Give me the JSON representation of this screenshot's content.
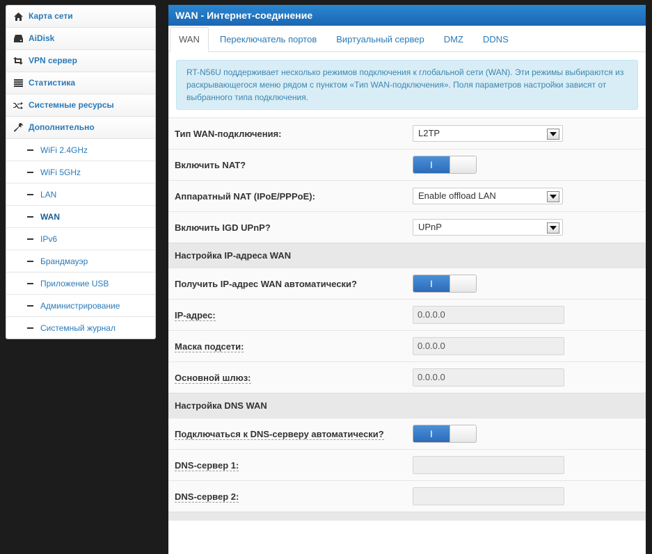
{
  "sidebar": {
    "items": [
      {
        "label": "Карта сети",
        "icon": "home-icon"
      },
      {
        "label": "AiDisk",
        "icon": "hdd-icon"
      },
      {
        "label": "VPN сервер",
        "icon": "retweet-icon"
      },
      {
        "label": "Статистика",
        "icon": "list-icon"
      },
      {
        "label": "Системные ресурсы",
        "icon": "random-icon"
      },
      {
        "label": "Дополнительно",
        "icon": "wrench-icon"
      }
    ],
    "subitems": [
      {
        "label": "WiFi 2.4GHz"
      },
      {
        "label": "WiFi 5GHz"
      },
      {
        "label": "LAN"
      },
      {
        "label": "WAN"
      },
      {
        "label": "IPv6"
      },
      {
        "label": "Брандмауэр"
      },
      {
        "label": "Приложение USB"
      },
      {
        "label": "Администрирование"
      },
      {
        "label": "Системный журнал"
      }
    ],
    "active_subitem": "WAN"
  },
  "header": {
    "title": "WAN - Интернет-соединение"
  },
  "tabs": [
    {
      "label": "WAN"
    },
    {
      "label": "Переключатель портов"
    },
    {
      "label": "Виртуальный сервер"
    },
    {
      "label": "DMZ"
    },
    {
      "label": "DDNS"
    }
  ],
  "info_text": "RT-N56U поддерживает несколько режимов подключения к глобальной сети (WAN). Эти режимы выбираются из раскрывающегося меню рядом с пунктом «Тип WAN-подключения». Поля параметров настройки зависят от выбранного типа подключения.",
  "form": {
    "wan_type_label": "Тип WAN-подключения:",
    "wan_type_value": "L2TP",
    "nat_label": "Включить NAT?",
    "nat_on": "I",
    "hw_nat_label": "Аппаратный NAT (IPoE/PPPoE):",
    "hw_nat_value": "Enable offload LAN",
    "upnp_label": "Включить IGD UPnP?",
    "upnp_value": "UPnP",
    "ip_section": "Настройка IP-адреса WAN",
    "auto_ip_label": "Получить IP-адрес WAN автоматически?",
    "auto_ip_on": "I",
    "ip_label": "IP-адрес:",
    "ip_value": "0.0.0.0",
    "mask_label": "Маска подсети:",
    "mask_value": "0.0.0.0",
    "gw_label": "Основной шлюз:",
    "gw_value": "0.0.0.0",
    "dns_section": "Настройка DNS WAN",
    "auto_dns_label": "Подключаться к DNS-серверу автоматически?",
    "auto_dns_on": "I",
    "dns1_label": "DNS-сервер 1:",
    "dns1_value": "",
    "dns2_label": "DNS-сервер 2:",
    "dns2_value": ""
  },
  "colors": {
    "header": "#1a66b3",
    "link": "#2a7ab8",
    "toggle_on": "#2c6bb8",
    "info_bg": "#d9edf7"
  }
}
